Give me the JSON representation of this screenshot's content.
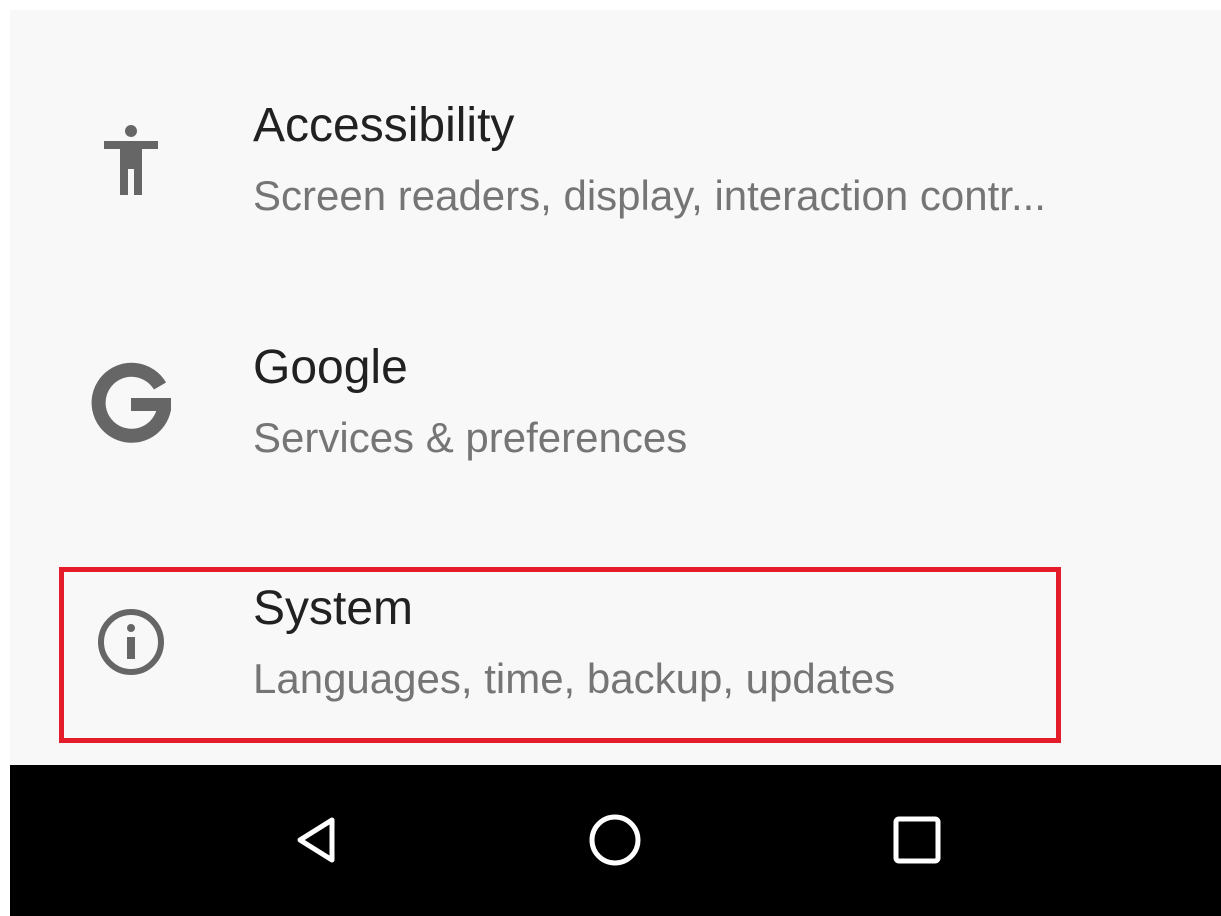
{
  "settings_list": {
    "items": [
      {
        "id": "accessibility",
        "icon": "accessibility-icon",
        "title": "Accessibility",
        "summary": "Screen readers, display, interaction contr..."
      },
      {
        "id": "google",
        "icon": "google-g-icon",
        "title": "Google",
        "summary": "Services & preferences"
      },
      {
        "id": "system",
        "icon": "info-circle-icon",
        "title": "System",
        "summary": "Languages, time, backup, updates"
      }
    ]
  },
  "highlight": {
    "target": "system",
    "color": "#e51d2a"
  },
  "nav_bar": {
    "buttons": [
      {
        "id": "back",
        "icon": "back-triangle-icon"
      },
      {
        "id": "home",
        "icon": "home-circle-icon"
      },
      {
        "id": "recents",
        "icon": "recents-square-icon"
      }
    ]
  },
  "colors": {
    "background": "#f8f8f8",
    "title": "#212121",
    "summary": "#757575",
    "icon": "#666666",
    "nav_bar": "#000000",
    "nav_icon": "#ffffff"
  }
}
